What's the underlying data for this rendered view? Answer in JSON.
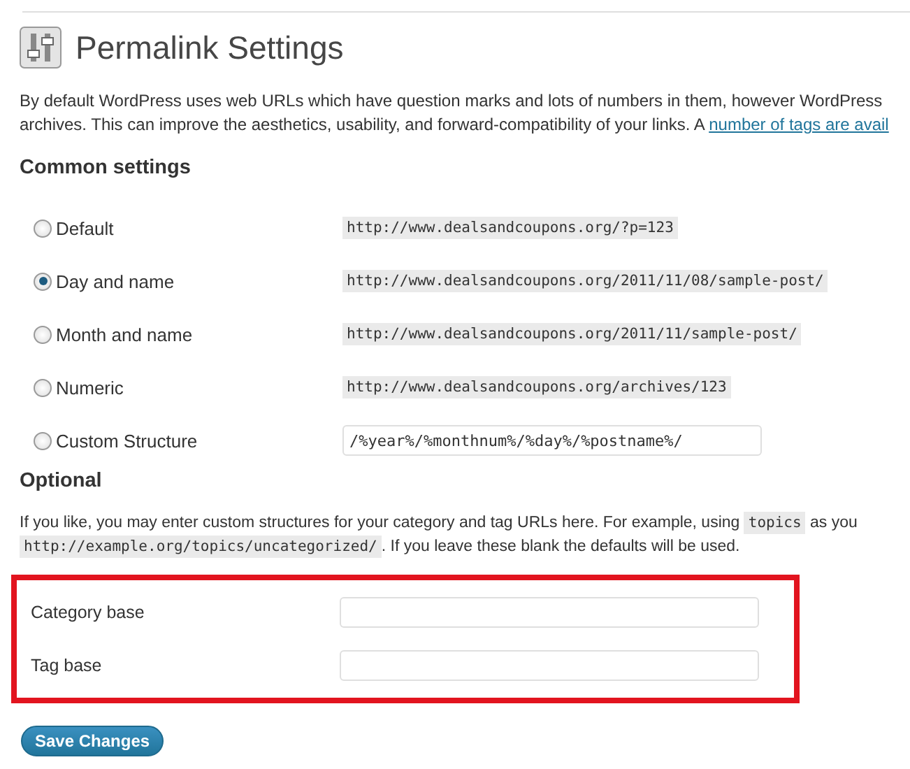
{
  "page": {
    "title": "Permalink Settings"
  },
  "intro": {
    "text": "By default WordPress uses web URLs which have question marks and lots of numbers in them, however WordPress",
    "text_2": "archives. This can improve the aesthetics, usability, and forward-compatibility of your links. A ",
    "link": "number of tags are avail"
  },
  "common_settings": {
    "heading": "Common settings",
    "options": [
      {
        "label": "Default",
        "kind": "sample",
        "example": "http://www.dealsandcoupons.org/?p=123",
        "selected": false
      },
      {
        "label": "Day and name",
        "kind": "sample",
        "example": "http://www.dealsandcoupons.org/2011/11/08/sample-post/",
        "selected": true
      },
      {
        "label": "Month and name",
        "kind": "sample",
        "example": "http://www.dealsandcoupons.org/2011/11/sample-post/",
        "selected": false
      },
      {
        "label": "Numeric",
        "kind": "sample",
        "example": "http://www.dealsandcoupons.org/archives/123",
        "selected": false
      },
      {
        "label": "Custom Structure",
        "kind": "field",
        "value": "/%year%/%monthnum%/%day%/%postname%/",
        "selected": false
      }
    ]
  },
  "optional": {
    "heading": "Optional",
    "text_start": "If you like, you may enter custom structures for your category and tag URLs here. For example, using ",
    "code": "topics",
    "text_end": " as you",
    "code_2": "http://example.org/topics/uncategorized/",
    "text_2": ". If you leave these blank the defaults will be used.",
    "fields": [
      {
        "label": "Category base"
      },
      {
        "label": "Tag base"
      }
    ]
  },
  "save_button": "Save Changes"
}
